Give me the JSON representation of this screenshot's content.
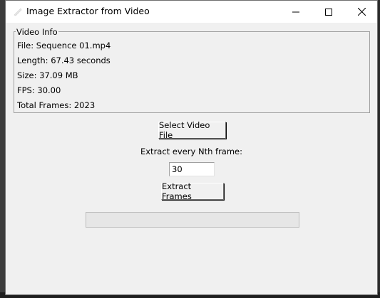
{
  "window": {
    "title": "Image Extractor from Video"
  },
  "video_info": {
    "legend": "Video Info",
    "file": "File: Sequence 01.mp4",
    "length": "Length: 67.43 seconds",
    "size": "Size: 37.09 MB",
    "fps": "FPS: 30.00",
    "total_frames": "Total Frames: 2023"
  },
  "controls": {
    "select_button": "Select Video File",
    "nth_label": "Extract every Nth frame:",
    "nth_value": "30",
    "extract_button": "Extract Frames"
  },
  "progress": {
    "value": 0
  },
  "icons": {
    "minimize": "minimize-icon",
    "maximize": "maximize-icon",
    "close": "close-icon"
  }
}
